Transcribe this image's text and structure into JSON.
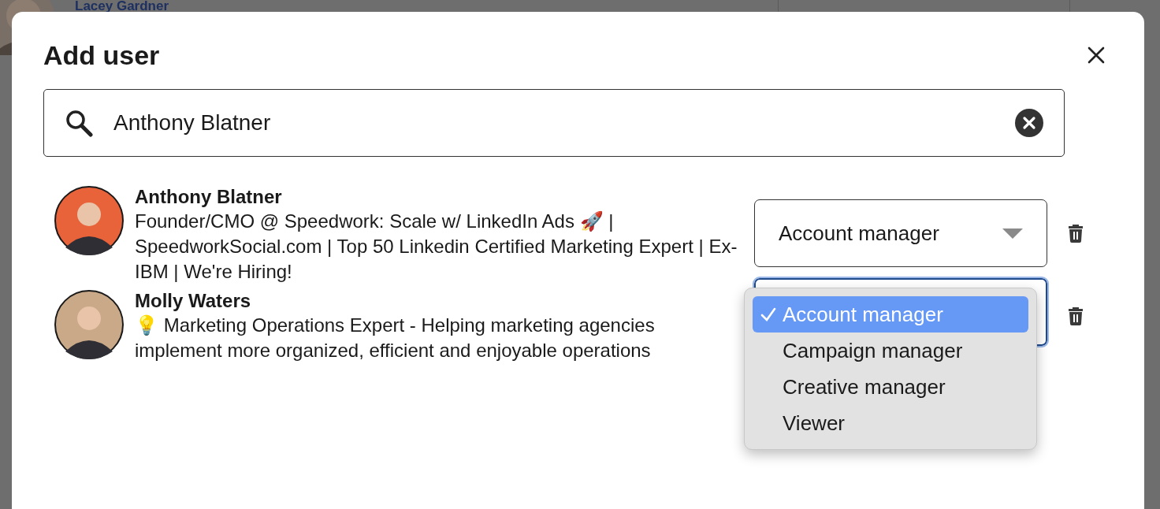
{
  "background": {
    "name": "Lacey Gardner"
  },
  "dialog": {
    "title": "Add user",
    "search": {
      "value": "Anthony Blatner"
    },
    "users": [
      {
        "name": "Anthony Blatner",
        "headline": "Founder/CMO @ Speedwork: Scale w/ LinkedIn Ads 🚀 | SpeedworkSocial.com | Top 50 Linkedin Certified Marketing Expert | Ex-IBM | We're Hiring!",
        "role": "Account manager",
        "focused": false
      },
      {
        "name": "Molly Waters",
        "headline": "💡 Marketing Operations Expert - Helping marketing agencies implement more organized, efficient and enjoyable operations",
        "focused": true,
        "menu": [
          {
            "label": "Account manager",
            "selected": true
          },
          {
            "label": "Campaign manager",
            "selected": false
          },
          {
            "label": "Creative manager",
            "selected": false
          },
          {
            "label": "Viewer",
            "selected": false
          }
        ]
      }
    ]
  }
}
